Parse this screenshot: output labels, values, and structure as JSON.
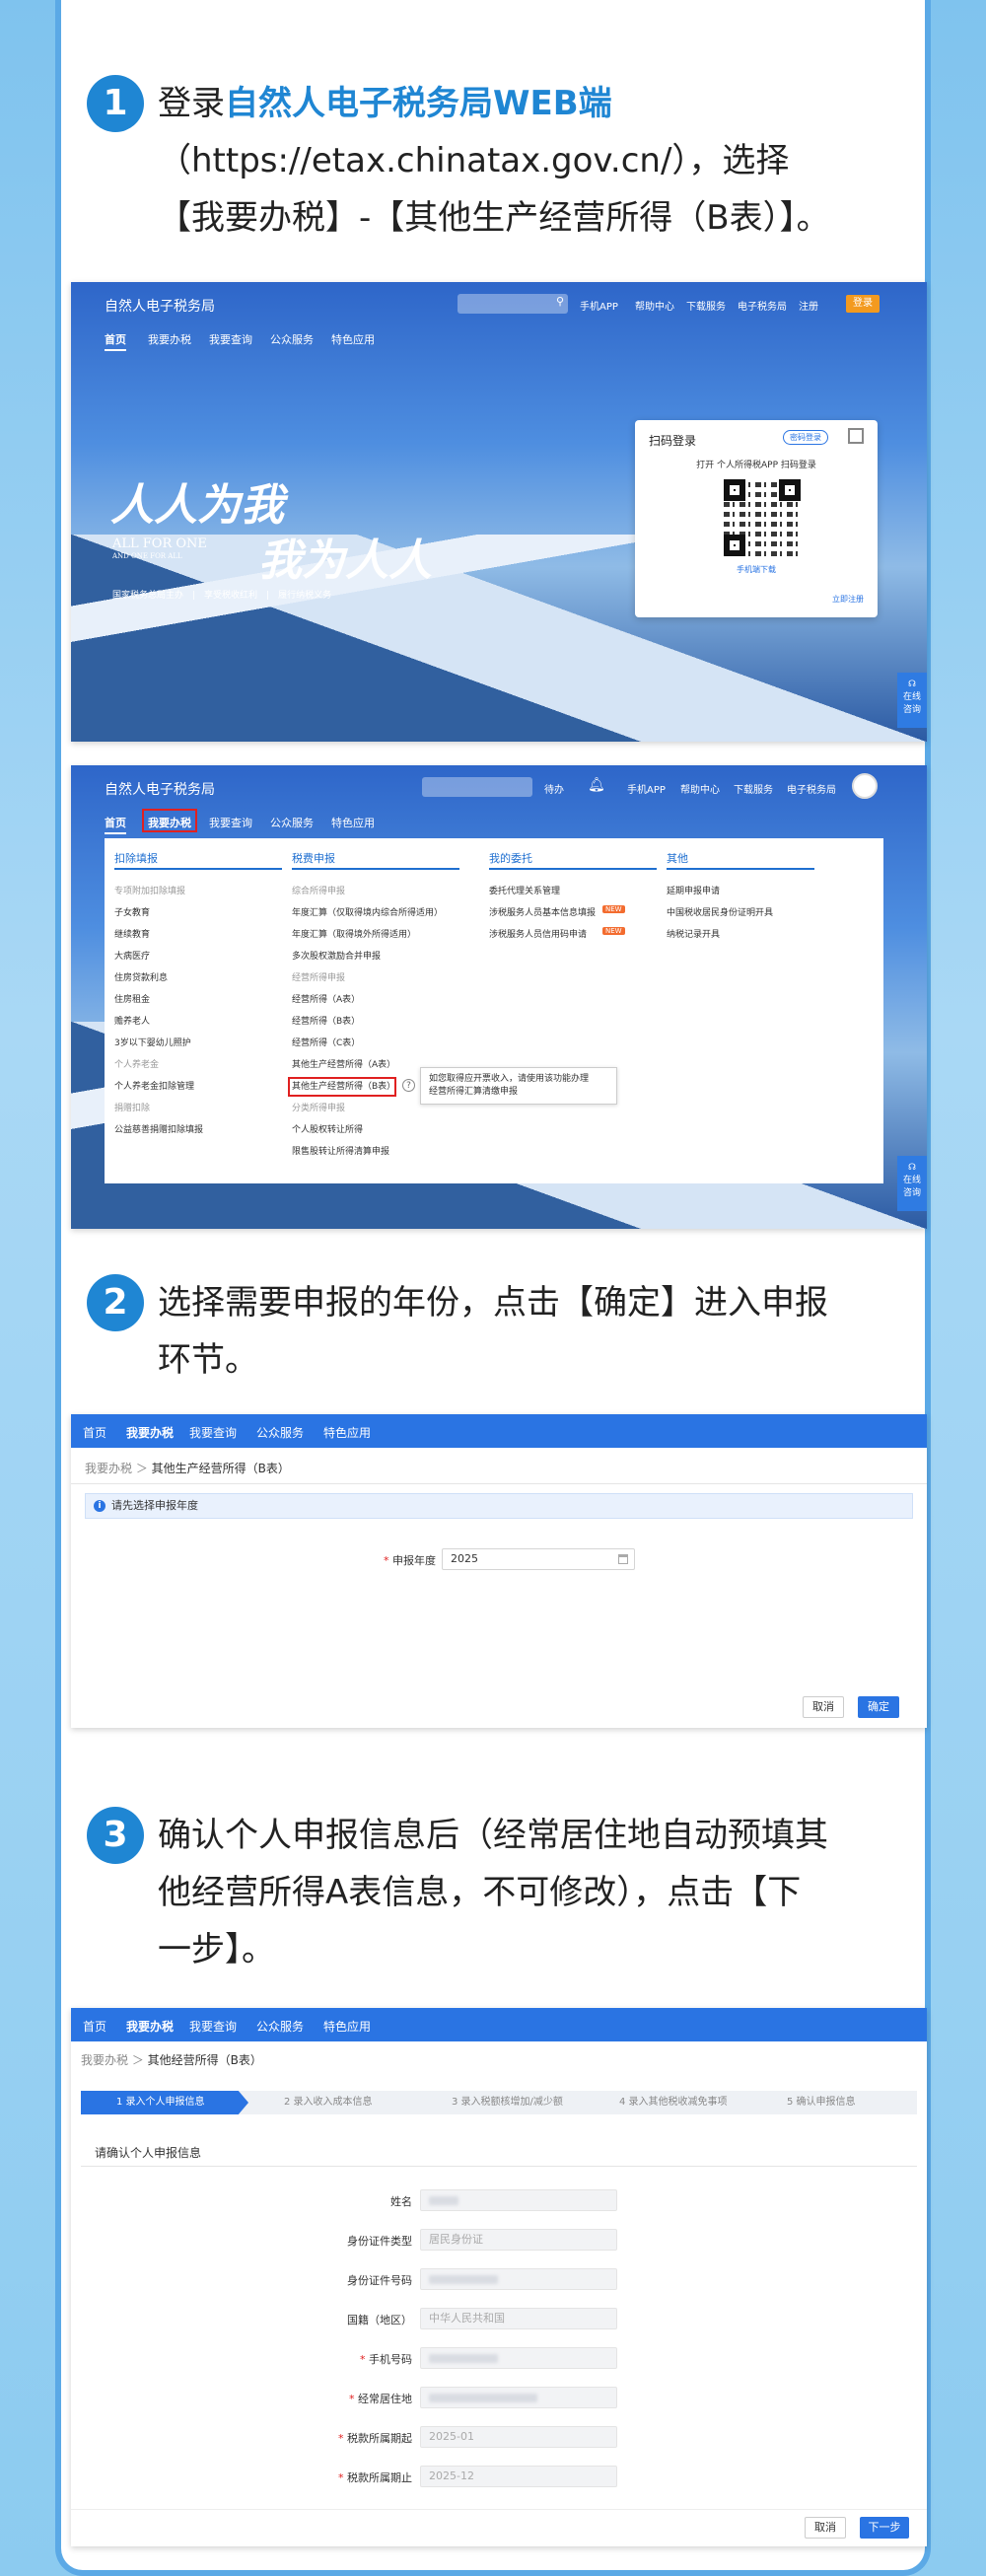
{
  "step1": {
    "num": "1",
    "pre": "登录",
    "highlight": "自然人电子税务局WEB端",
    "line2": "（https://etax.chinatax.gov.cn/），选择",
    "line3": "【我要办税】-【其他生产经营所得（B表）】。"
  },
  "site": {
    "brand": "自然人电子税务局",
    "nav": [
      "首页",
      "我要办税",
      "我要查询",
      "公众服务",
      "特色应用"
    ],
    "links": [
      "手机APP",
      "帮助中心",
      "下载服务",
      "电子税务局",
      "注册"
    ],
    "login": "登录"
  },
  "hero": {
    "slogan_a": "人人为我",
    "slogan_b": "我为人人",
    "slogan_en": "ALL FOR ONE",
    "slogan_en2": "AND ONE FOR ALL",
    "motto": "国家税务总局主办　|　享受税收红利　|　履行纳税义务"
  },
  "qr": {
    "title": "扫码登录",
    "tag": "密码登录",
    "hint": "打开 个人所得税APP 扫码登录",
    "download": "手机端下载",
    "register": "立即注册"
  },
  "help": "在线\n咨询",
  "site2": {
    "links": [
      "待办",
      "手机APP",
      "帮助中心",
      "下载服务",
      "电子税务局"
    ]
  },
  "menu": {
    "cols": [
      {
        "title": "扣除填报",
        "items": [
          [
            "专项附加扣除填报",
            "gray"
          ],
          [
            "子女教育",
            ""
          ],
          [
            "继续教育",
            ""
          ],
          [
            "大病医疗",
            ""
          ],
          [
            "住房贷款利息",
            ""
          ],
          [
            "住房租金",
            ""
          ],
          [
            "赡养老人",
            ""
          ],
          [
            "3岁以下婴幼儿照护",
            ""
          ],
          [
            "个人养老金",
            "gray"
          ],
          [
            "个人养老金扣除管理",
            ""
          ],
          [
            "捐赠扣除",
            "gray"
          ],
          [
            "公益慈善捐赠扣除填报",
            ""
          ]
        ]
      },
      {
        "title": "税费申报",
        "items": [
          [
            "综合所得申报",
            "gray"
          ],
          [
            "年度汇算（仅取得境内综合所得适用）",
            ""
          ],
          [
            "年度汇算（取得境外所得适用）",
            ""
          ],
          [
            "多次股权激励合并申报",
            ""
          ],
          [
            "经营所得申报",
            "gray"
          ],
          [
            "经营所得（A表）",
            ""
          ],
          [
            "经营所得（B表）",
            ""
          ],
          [
            "经营所得（C表）",
            ""
          ],
          [
            "其他生产经营所得（A表）",
            ""
          ],
          [
            "其他生产经营所得（B表）",
            ""
          ],
          [
            "分类所得申报",
            "gray"
          ],
          [
            "个人股权转让所得",
            ""
          ],
          [
            "限售股转让所得清算申报",
            ""
          ]
        ]
      },
      {
        "title": "我的委托",
        "items": [
          [
            "委托代理关系管理",
            ""
          ],
          [
            "涉税服务人员基本信息填报",
            ""
          ],
          [
            "涉税服务人员信用码申请",
            ""
          ]
        ]
      },
      {
        "title": "其他",
        "items": [
          [
            "延期申报申请",
            ""
          ],
          [
            "中国税收居民身份证明开具",
            ""
          ],
          [
            "纳税记录开具",
            ""
          ]
        ]
      }
    ],
    "new": "NEW",
    "tip": "如您取得应开票收入，请使用该功能办理\n经营所得汇算清缴申报"
  },
  "step2": {
    "num": "2",
    "line1": "选择需要申报的年份，点击【确定】进入申报",
    "line2": "环节。"
  },
  "form1": {
    "nav": [
      "首页",
      "我要办税",
      "我要查询",
      "公众服务",
      "特色应用"
    ],
    "crumb_a": "我要办税",
    "crumb_b": "其他生产经营所得（B表）",
    "notice": "请先选择申报年度",
    "label": "申报年度",
    "year": "2025",
    "cancel": "取消",
    "ok": "确定"
  },
  "step3": {
    "num": "3",
    "line1": "确认个人申报信息后（经常居住地自动预填其",
    "line2": "他经营所得A表信息，不可修改），点击【下",
    "line3": "一步】。"
  },
  "form2": {
    "nav": [
      "首页",
      "我要办税",
      "我要查询",
      "公众服务",
      "特色应用"
    ],
    "crumb_a": "我要办税",
    "crumb_b": "其他经营所得（B表）",
    "steps": [
      "1  录入个人申报信息",
      "2  录入收入成本信息",
      "3  录入税额核增加/减少额",
      "4  录入其他税收减免事项",
      "5  确认申报信息"
    ],
    "section": "请确认个人申报信息",
    "fields": [
      [
        "姓名",
        "",
        "blur"
      ],
      [
        "身份证件类型",
        "居民身份证",
        ""
      ],
      [
        "身份证件号码",
        "",
        "blur"
      ],
      [
        "国籍（地区）",
        "中华人民共和国",
        ""
      ],
      [
        "手机号码",
        "",
        "blur-req"
      ],
      [
        "经常居住地",
        "",
        "blur-req"
      ],
      [
        "税款所属期起",
        "2025-01",
        "req"
      ],
      [
        "税款所属期止",
        "2025-12",
        "req"
      ]
    ],
    "cancel": "取消",
    "next": "下一步"
  }
}
